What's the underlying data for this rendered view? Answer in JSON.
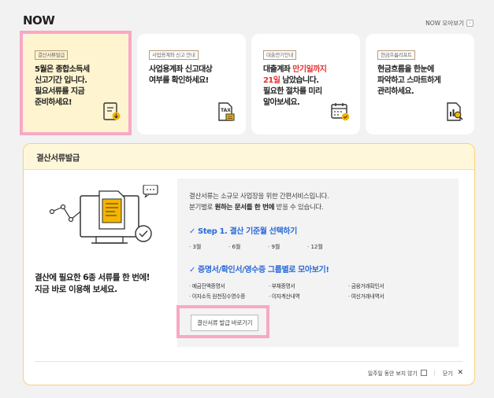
{
  "now": {
    "title": "NOW",
    "more_label": "NOW 모아보기",
    "more_icon": "chevron-right-icon"
  },
  "cards": [
    {
      "badge": "결산서류발급",
      "line1": "5월은 종합소득세",
      "line2": "신고기간 입니다.",
      "line3": "필요서류를 지금",
      "line4": "준비하세요!",
      "icon": "document-download-icon"
    },
    {
      "badge": "사업용계좌 신고 안내",
      "line1": "사업용계좌 신고대상",
      "line2": "여부를 확인하세요!",
      "icon": "tax-document-icon"
    },
    {
      "badge": "대출만기안내",
      "line1": "대출계좌 ",
      "line1_hl": "만기일까지",
      "line2_hl": "21일",
      "line2": " 남았습니다.",
      "line3": "필요한 절차를 미리",
      "line4": "알아보세요.",
      "icon": "calendar-check-icon"
    },
    {
      "badge": "현금흐름리포트",
      "line1": "현금흐름을 한눈에",
      "line2": "파악하고 스마트하게",
      "line3": "관리하세요.",
      "icon": "report-search-icon"
    }
  ],
  "panel": {
    "title": "결산서류발급",
    "left_line1": "결산에 필요한 6종 서류를 한 번에!",
    "left_line2": "지금 바로 이용해 보세요.",
    "desc_line1": "결산서류는 소규모 사업장을 위한 간편서비스입니다.",
    "desc_line2_a": "분기별로 ",
    "desc_line2_b": "원하는 문서를 한 번에",
    "desc_line2_c": " 받을 수 있습니다.",
    "step_title": "✓ Step 1. 결산 기준월 선택하기",
    "months": [
      "· 3월",
      "· 6월",
      "· 9월",
      "· 12월"
    ],
    "group_title": "✓ 증명서/확인서/영수증 그룹별로 모아보기!",
    "docs": [
      "· 예금잔액증명서",
      "· 부채증명서",
      "· 금융거래확인서",
      "· 이자소득 원천징수영수증",
      "· 이자계산내역",
      "· 여신거래내역서"
    ],
    "go_button": "결산서류 발급 바로가기",
    "hide_week": "일주일 동안 보지 않기",
    "close_label": "닫기",
    "close_icon": "close-icon"
  },
  "colors": {
    "accent_yellow": "#fff4d0",
    "panel_border": "#f5d27a",
    "highlight_pink": "#f7a9c4",
    "step_blue": "#2a6ad8",
    "alert_red": "#e8312f"
  }
}
